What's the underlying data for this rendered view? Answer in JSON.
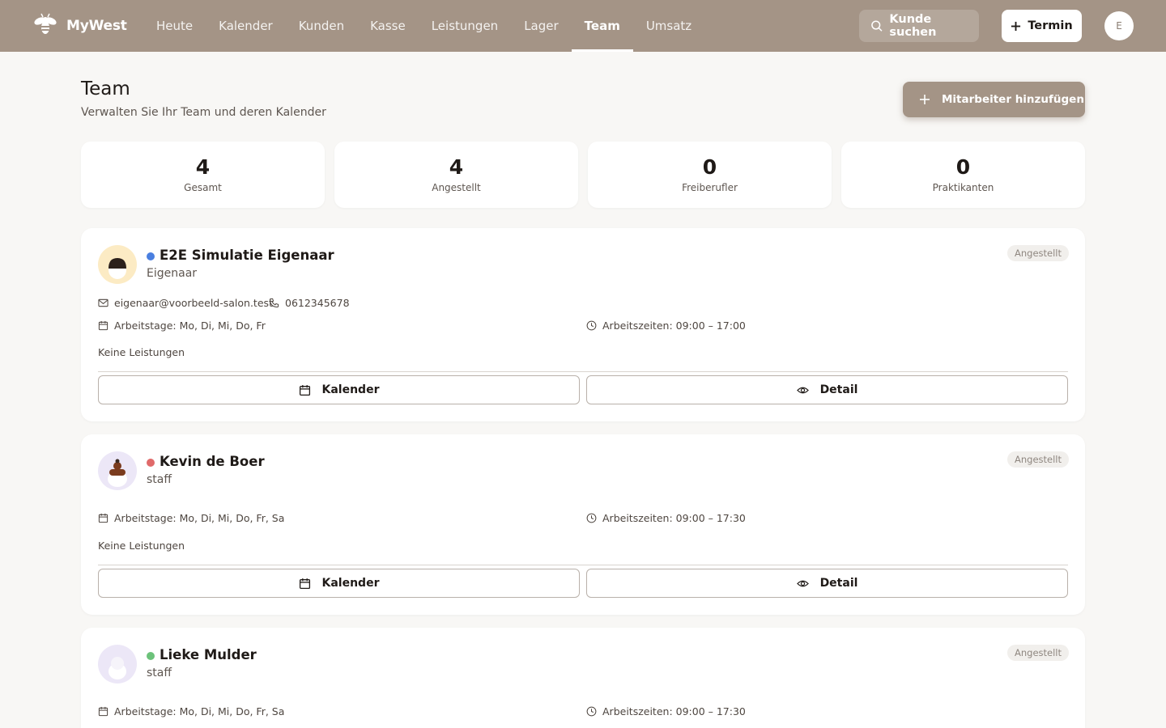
{
  "app": {
    "name": "MyWest"
  },
  "nav": {
    "items": [
      {
        "label": "Heute"
      },
      {
        "label": "Kalender"
      },
      {
        "label": "Kunden"
      },
      {
        "label": "Kasse"
      },
      {
        "label": "Leistungen"
      },
      {
        "label": "Lager"
      },
      {
        "label": "Team",
        "active": true
      },
      {
        "label": "Umsatz"
      }
    ],
    "search_label": "Kunde suchen",
    "new_appointment_label": "Termin",
    "user_initial": "E"
  },
  "page": {
    "title": "Team",
    "subtitle": "Verwalten Sie Ihr Team und deren Kalender",
    "add_button_label": "Mitarbeiter hinzufügen"
  },
  "stats": [
    {
      "value": "4",
      "label": "Gesamt"
    },
    {
      "value": "4",
      "label": "Angestellt"
    },
    {
      "value": "0",
      "label": "Freiberufler"
    },
    {
      "value": "0",
      "label": "Praktikanten"
    }
  ],
  "staff": [
    {
      "name": "E2E Simulatie Eigenaar",
      "role": "Eigenaar",
      "color": "#4a7fe0",
      "badge": "Angestellt",
      "email": "eigenaar@voorbeeld-salon.test",
      "phone": "0612345678",
      "workdays": "Arbeitstage: Mo, Di, Mi, Do, Fr",
      "hours": "Arbeitszeiten: 09:00 – 17:00",
      "services": "Keine Leistungen",
      "calendar_label": "Kalender",
      "detail_label": "Detail"
    },
    {
      "name": "Kevin de Boer",
      "role": "staff",
      "color": "#e06a6a",
      "badge": "Angestellt",
      "workdays": "Arbeitstage: Mo, Di, Mi, Do, Fr, Sa",
      "hours": "Arbeitszeiten: 09:00 – 17:30",
      "services": "Keine Leistungen",
      "calendar_label": "Kalender",
      "detail_label": "Detail"
    },
    {
      "name": "Lieke Mulder",
      "role": "staff",
      "color": "#6cc27a",
      "badge": "Angestellt",
      "workdays": "Arbeitstage: Mo, Di, Mi, Do, Fr, Sa",
      "hours": "Arbeitszeiten: 09:00 – 17:30"
    }
  ],
  "colors": {
    "header_bg": "#a49486",
    "page_bg": "#f8f7f5",
    "accent": "#a49486"
  }
}
